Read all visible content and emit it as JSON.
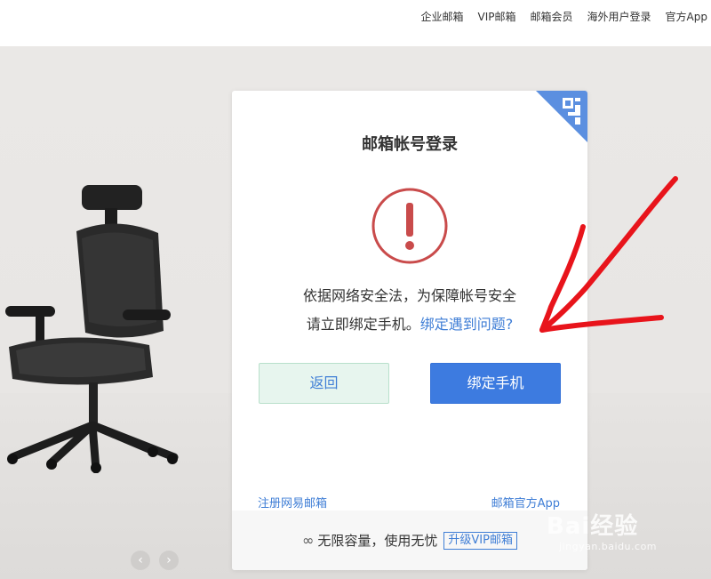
{
  "top_nav": [
    "企业邮箱",
    "VIP邮箱",
    "邮箱会员",
    "海外用户登录",
    "官方App"
  ],
  "card": {
    "title": "邮箱帐号登录",
    "message_line1": "依据网络安全法，为保障帐号安全",
    "message_line2": "请立即绑定手机。",
    "problem_link": "绑定遇到问题?",
    "back_button": "返回",
    "bind_button": "绑定手机",
    "register_link": "注册网易邮箱",
    "app_link": "邮箱官方App",
    "footer_text": "无限容量，使用无忧",
    "footer_vip": "升级VIP邮箱"
  },
  "carousel": {
    "prev": "‹",
    "next": "›"
  },
  "watermark": {
    "brand": "Bai经验",
    "url": "jingyan.baidu.com"
  },
  "colors": {
    "accent": "#3d7be0",
    "warning": "#c94b4b",
    "annotation": "#e8141b"
  },
  "icons": [
    "qr-code-icon",
    "warning-icon",
    "infinity-icon",
    "chevron-left-icon",
    "chevron-right-icon"
  ]
}
